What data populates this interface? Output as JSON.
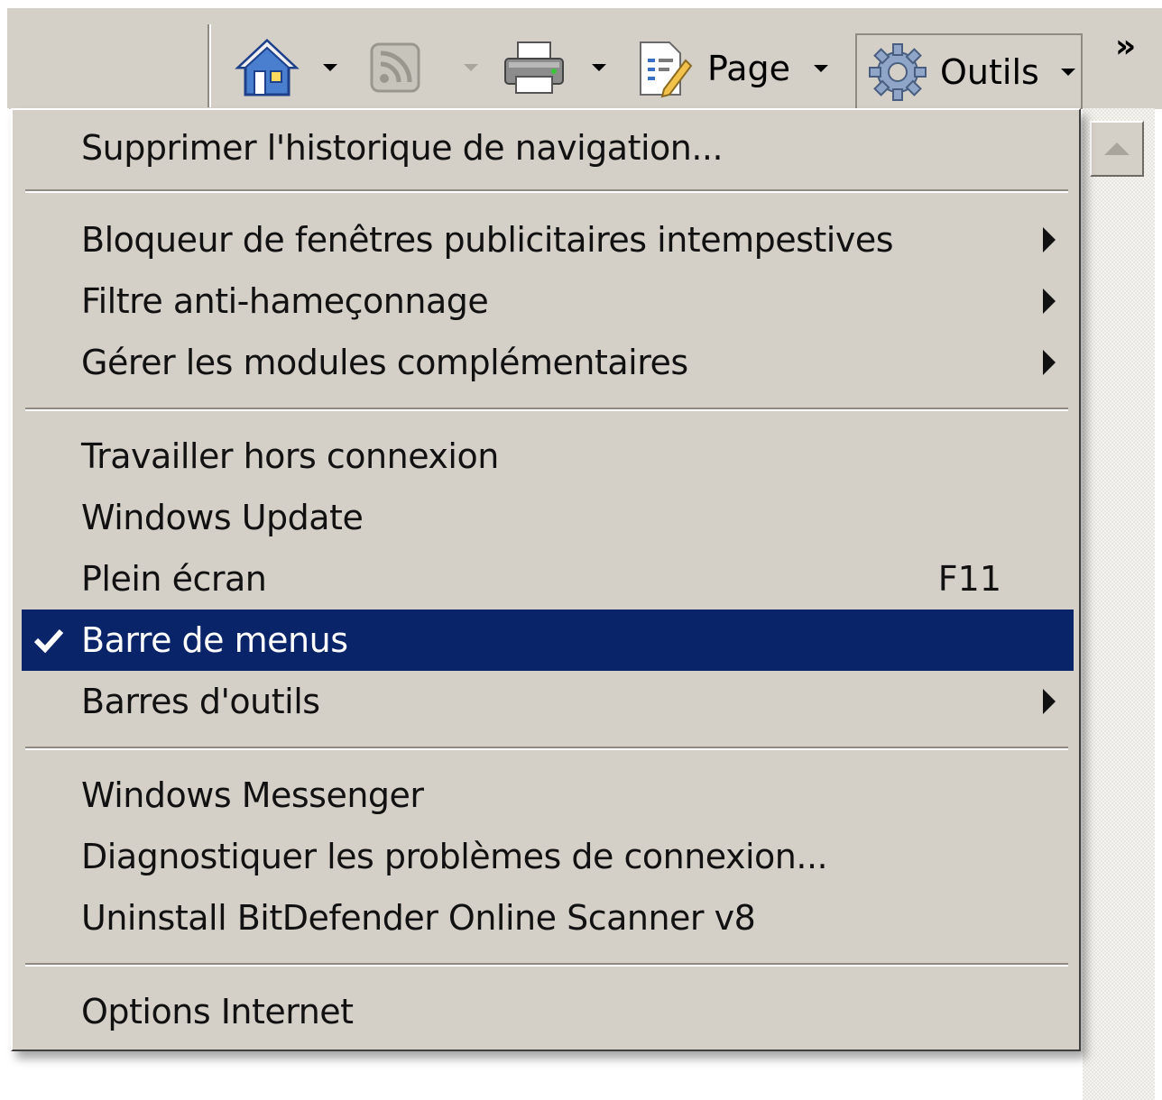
{
  "toolbar": {
    "home_icon": "home-icon",
    "feeds_icon": "rss-feeds-icon",
    "print_icon": "printer-icon",
    "page_label": "Page",
    "page_icon": "page-icon",
    "tools_label": "Outils",
    "tools_icon": "gear-icon",
    "overflow_label": "»"
  },
  "menu": {
    "items": [
      {
        "label": "Supprimer l'historique de navigation..."
      },
      {
        "label": "Bloqueur de fenêtres publicitaires intempestives",
        "submenu": true
      },
      {
        "label": "Filtre anti-hameçonnage",
        "submenu": true
      },
      {
        "label": "Gérer les modules complémentaires",
        "submenu": true
      },
      {
        "label": "Travailler hors connexion"
      },
      {
        "label": "Windows Update"
      },
      {
        "label": "Plein écran",
        "shortcut": "F11"
      },
      {
        "label": "Barre de menus",
        "checked": true,
        "selected": true
      },
      {
        "label": "Barres d'outils",
        "submenu": true
      },
      {
        "label": "Windows Messenger"
      },
      {
        "label": "Diagnostiquer les problèmes de connexion..."
      },
      {
        "label": "Uninstall BitDefender Online Scanner v8"
      },
      {
        "label": "Options Internet"
      }
    ]
  },
  "colors": {
    "menu_background": "#d4d0c8",
    "selection": "#0a246a",
    "selection_text": "#ffffff"
  }
}
